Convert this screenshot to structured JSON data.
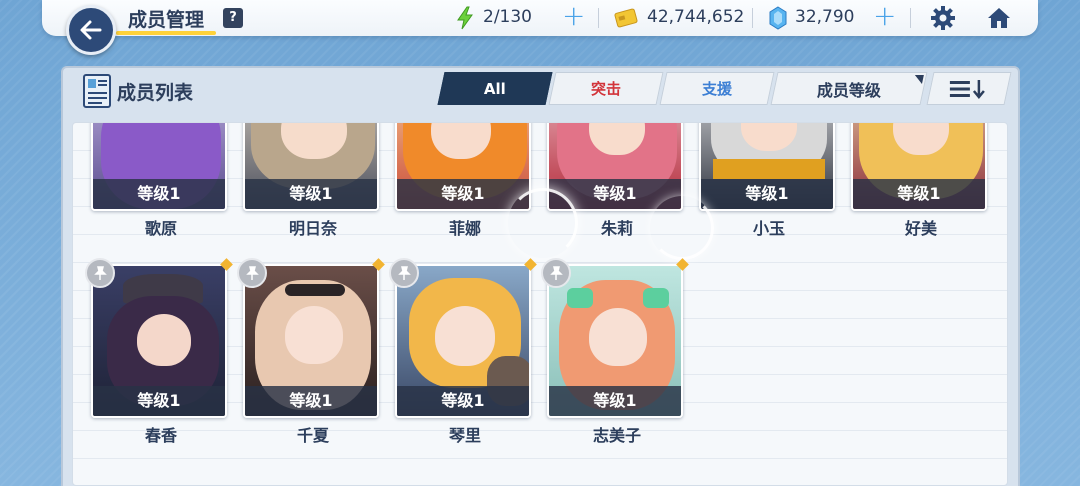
{
  "header": {
    "title": "成员管理",
    "help_label": "?",
    "stamina": "2/130",
    "credits": "42,744,652",
    "gems": "32,790"
  },
  "panel": {
    "title": "成员列表",
    "tabs": [
      {
        "label": "All",
        "active": true
      },
      {
        "label": "突击",
        "color": "#d2343a"
      },
      {
        "label": "支援",
        "color": "#3c7fd4"
      }
    ],
    "sort_label": "成员等级"
  },
  "members_row1": [
    {
      "level": "等级1",
      "name": "歌原",
      "hair": "#8a5ac8"
    },
    {
      "level": "等级1",
      "name": "明日奈",
      "hair": "#b9a68c"
    },
    {
      "level": "等级1",
      "name": "菲娜",
      "hair": "#f08a2a"
    },
    {
      "level": "等级1",
      "name": "朱莉",
      "hair": "#e27388"
    },
    {
      "level": "等级1",
      "name": "小玉",
      "hair": "#d8d8d8"
    },
    {
      "level": "等级1",
      "name": "好美",
      "hair": "#f0c058"
    }
  ],
  "members_row2": [
    {
      "level": "等级1",
      "name": "春香",
      "hair": "#3a2a48"
    },
    {
      "level": "等级1",
      "name": "千夏",
      "hair": "#e8c8b0"
    },
    {
      "level": "等级1",
      "name": "琴里",
      "hair": "#f2b74a"
    },
    {
      "level": "等级1",
      "name": "志美子",
      "hair": "#f09a72"
    }
  ]
}
